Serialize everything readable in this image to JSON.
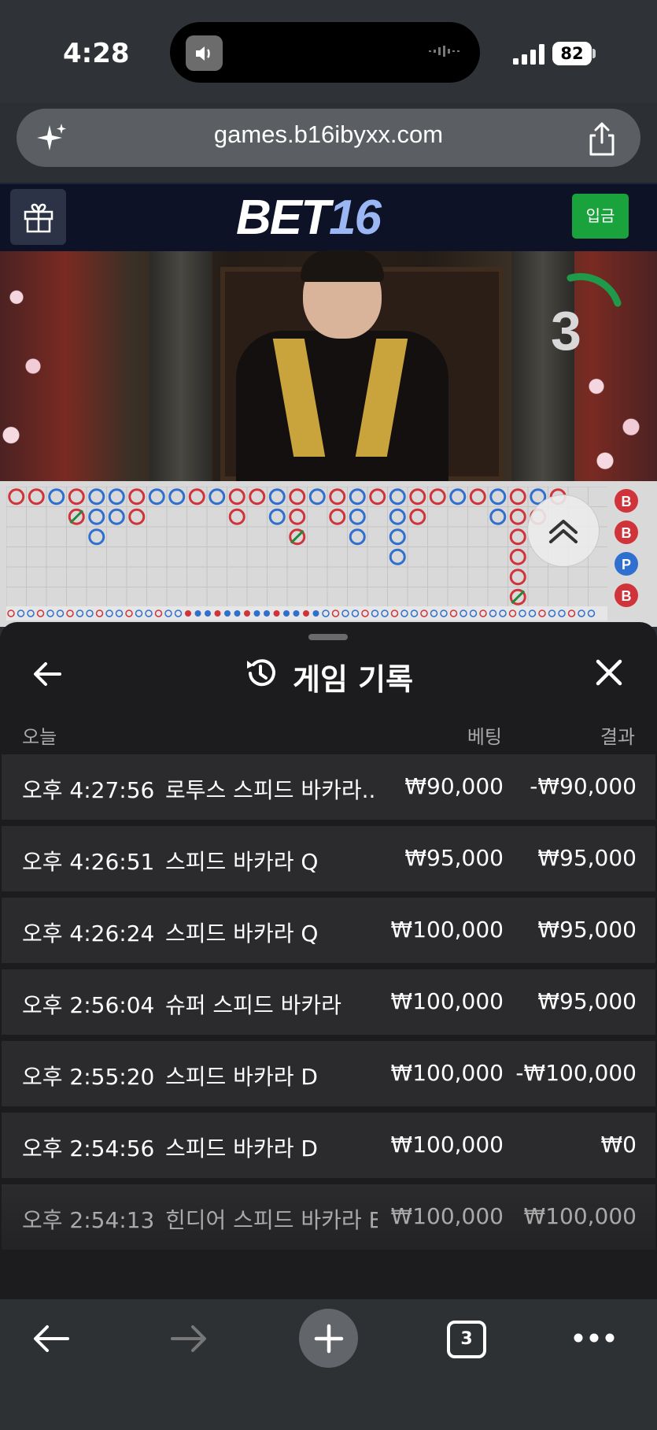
{
  "status_bar": {
    "time": "4:28",
    "battery": "82"
  },
  "browser": {
    "url": "games.b16ibyxx.com"
  },
  "site": {
    "logo_bet": "BET",
    "logo_num": "16",
    "deposit_label": "입금"
  },
  "game_view": {
    "countdown": "3"
  },
  "sheet": {
    "title": "게임 기록",
    "col_today": "오늘",
    "col_bet": "베팅",
    "col_result": "결과",
    "rows": [
      {
        "time": "오후 4:27:56",
        "game": "로투스 스피드 바카라...",
        "bet": "₩90,000",
        "result": "-₩90,000"
      },
      {
        "time": "오후 4:26:51",
        "game": "스피드 바카라 Q",
        "bet": "₩95,000",
        "result": "₩95,000"
      },
      {
        "time": "오후 4:26:24",
        "game": "스피드 바카라 Q",
        "bet": "₩100,000",
        "result": "₩95,000"
      },
      {
        "time": "오후 2:56:04",
        "game": "슈퍼 스피드 바카라",
        "bet": "₩100,000",
        "result": "₩95,000"
      },
      {
        "time": "오후 2:55:20",
        "game": "스피드 바카라 D",
        "bet": "₩100,000",
        "result": "-₩100,000"
      },
      {
        "time": "오후 2:54:56",
        "game": "스피드 바카라 D",
        "bet": "₩100,000",
        "result": "₩0"
      },
      {
        "time": "오후 2:54:13",
        "game": "힌디어 스피드 바카라 B",
        "bet": "₩100,000",
        "result": "₩100,000"
      }
    ]
  },
  "bottom_bar": {
    "tab_count": "3"
  },
  "colors": {
    "banker_red": "#d0343a",
    "player_blue": "#2f6fcf",
    "tie_green": "#1f8a3a",
    "deposit_green": "#1aa33c",
    "logo_accent": "#9ab6f3"
  },
  "roadmap": {
    "bead_labels": [
      "B",
      "B",
      "P",
      "B"
    ]
  }
}
